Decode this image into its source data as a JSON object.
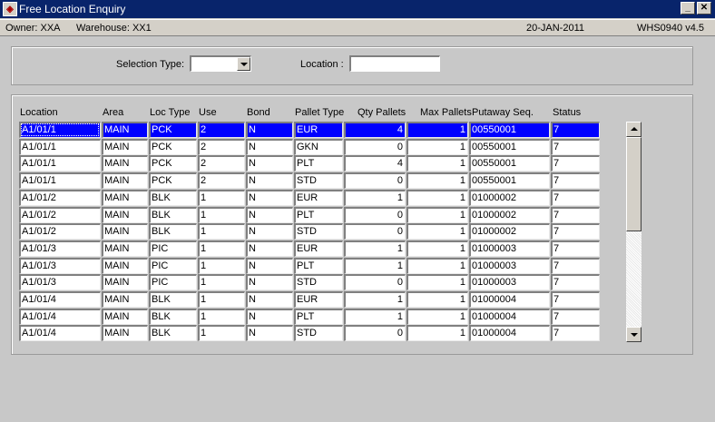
{
  "window": {
    "title": "Free Location Enquiry",
    "minimize_label": "_",
    "close_label": "✕"
  },
  "status": {
    "owner": "Owner:  XXA",
    "warehouse": "Warehouse:  XX1",
    "date": "20-JAN-2011",
    "version": "WHS0940  v4.5"
  },
  "criteria": {
    "selection_type_label": "Selection Type:",
    "selection_type_value": "",
    "location_label": "Location :",
    "location_value": ""
  },
  "table": {
    "headers": [
      "Location",
      "Area",
      "Loc Type",
      "Use",
      "Bond",
      "Pallet Type",
      "Qty Pallets",
      "Max Pallets",
      "Putaway Seq.",
      "Status"
    ],
    "rows": [
      [
        "A1/01/1",
        "MAIN",
        "PCK",
        "2",
        "N",
        "EUR",
        "4",
        "1",
        "00550001",
        "7"
      ],
      [
        "A1/01/1",
        "MAIN",
        "PCK",
        "2",
        "N",
        "GKN",
        "0",
        "1",
        "00550001",
        "7"
      ],
      [
        "A1/01/1",
        "MAIN",
        "PCK",
        "2",
        "N",
        "PLT",
        "4",
        "1",
        "00550001",
        "7"
      ],
      [
        "A1/01/1",
        "MAIN",
        "PCK",
        "2",
        "N",
        "STD",
        "0",
        "1",
        "00550001",
        "7"
      ],
      [
        "A1/01/2",
        "MAIN",
        "BLK",
        "1",
        "N",
        "EUR",
        "1",
        "1",
        "01000002",
        "7"
      ],
      [
        "A1/01/2",
        "MAIN",
        "BLK",
        "1",
        "N",
        "PLT",
        "0",
        "1",
        "01000002",
        "7"
      ],
      [
        "A1/01/2",
        "MAIN",
        "BLK",
        "1",
        "N",
        "STD",
        "0",
        "1",
        "01000002",
        "7"
      ],
      [
        "A1/01/3",
        "MAIN",
        "PIC",
        "1",
        "N",
        "EUR",
        "1",
        "1",
        "01000003",
        "7"
      ],
      [
        "A1/01/3",
        "MAIN",
        "PIC",
        "1",
        "N",
        "PLT",
        "1",
        "1",
        "01000003",
        "7"
      ],
      [
        "A1/01/3",
        "MAIN",
        "PIC",
        "1",
        "N",
        "STD",
        "0",
        "1",
        "01000003",
        "7"
      ],
      [
        "A1/01/4",
        "MAIN",
        "BLK",
        "1",
        "N",
        "EUR",
        "1",
        "1",
        "01000004",
        "7"
      ],
      [
        "A1/01/4",
        "MAIN",
        "BLK",
        "1",
        "N",
        "PLT",
        "1",
        "1",
        "01000004",
        "7"
      ],
      [
        "A1/01/4",
        "MAIN",
        "BLK",
        "1",
        "N",
        "STD",
        "0",
        "1",
        "01000004",
        "7"
      ]
    ],
    "selected_row": 0
  },
  "colors": {
    "titlebar": "#08246b",
    "selection": "#0000ff",
    "background": "#c8c8c8"
  },
  "icons": {
    "app": "forms-app-icon",
    "scroll_up": "arrow-up-icon",
    "scroll_down": "arrow-down-icon",
    "dropdown": "chevron-down-icon"
  }
}
